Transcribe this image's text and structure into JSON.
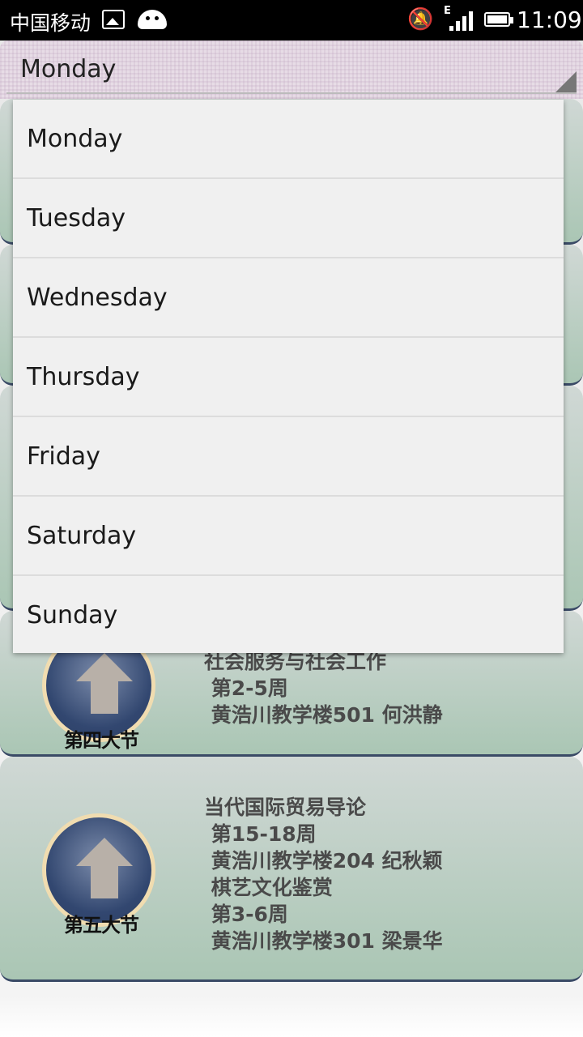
{
  "status_bar": {
    "carrier": "中国移动",
    "network": "E",
    "time": "11:09"
  },
  "spinner": {
    "selected": "Monday"
  },
  "dropdown": {
    "items": [
      "Monday",
      "Tuesday",
      "Wednesday",
      "Thursday",
      "Friday",
      "Saturday",
      "Sunday"
    ]
  },
  "courses": [
    {
      "period": "第四大节",
      "text": "社会服务与社会工作\n 第2-5周\n 黄浩川教学楼501 何洪静"
    },
    {
      "period": "第五大节",
      "text": "当代国际贸易导论\n 第15-18周\n 黄浩川教学楼204 纪秋颖\n 棋艺文化鉴赏\n 第3-6周\n 黄浩川教学楼301 梁景华"
    }
  ],
  "colors": {
    "card_top": "#d0d8d5",
    "card_bottom": "#aac6b4",
    "badge_ring": "#f0dcb0",
    "badge_fill": "#324770"
  }
}
